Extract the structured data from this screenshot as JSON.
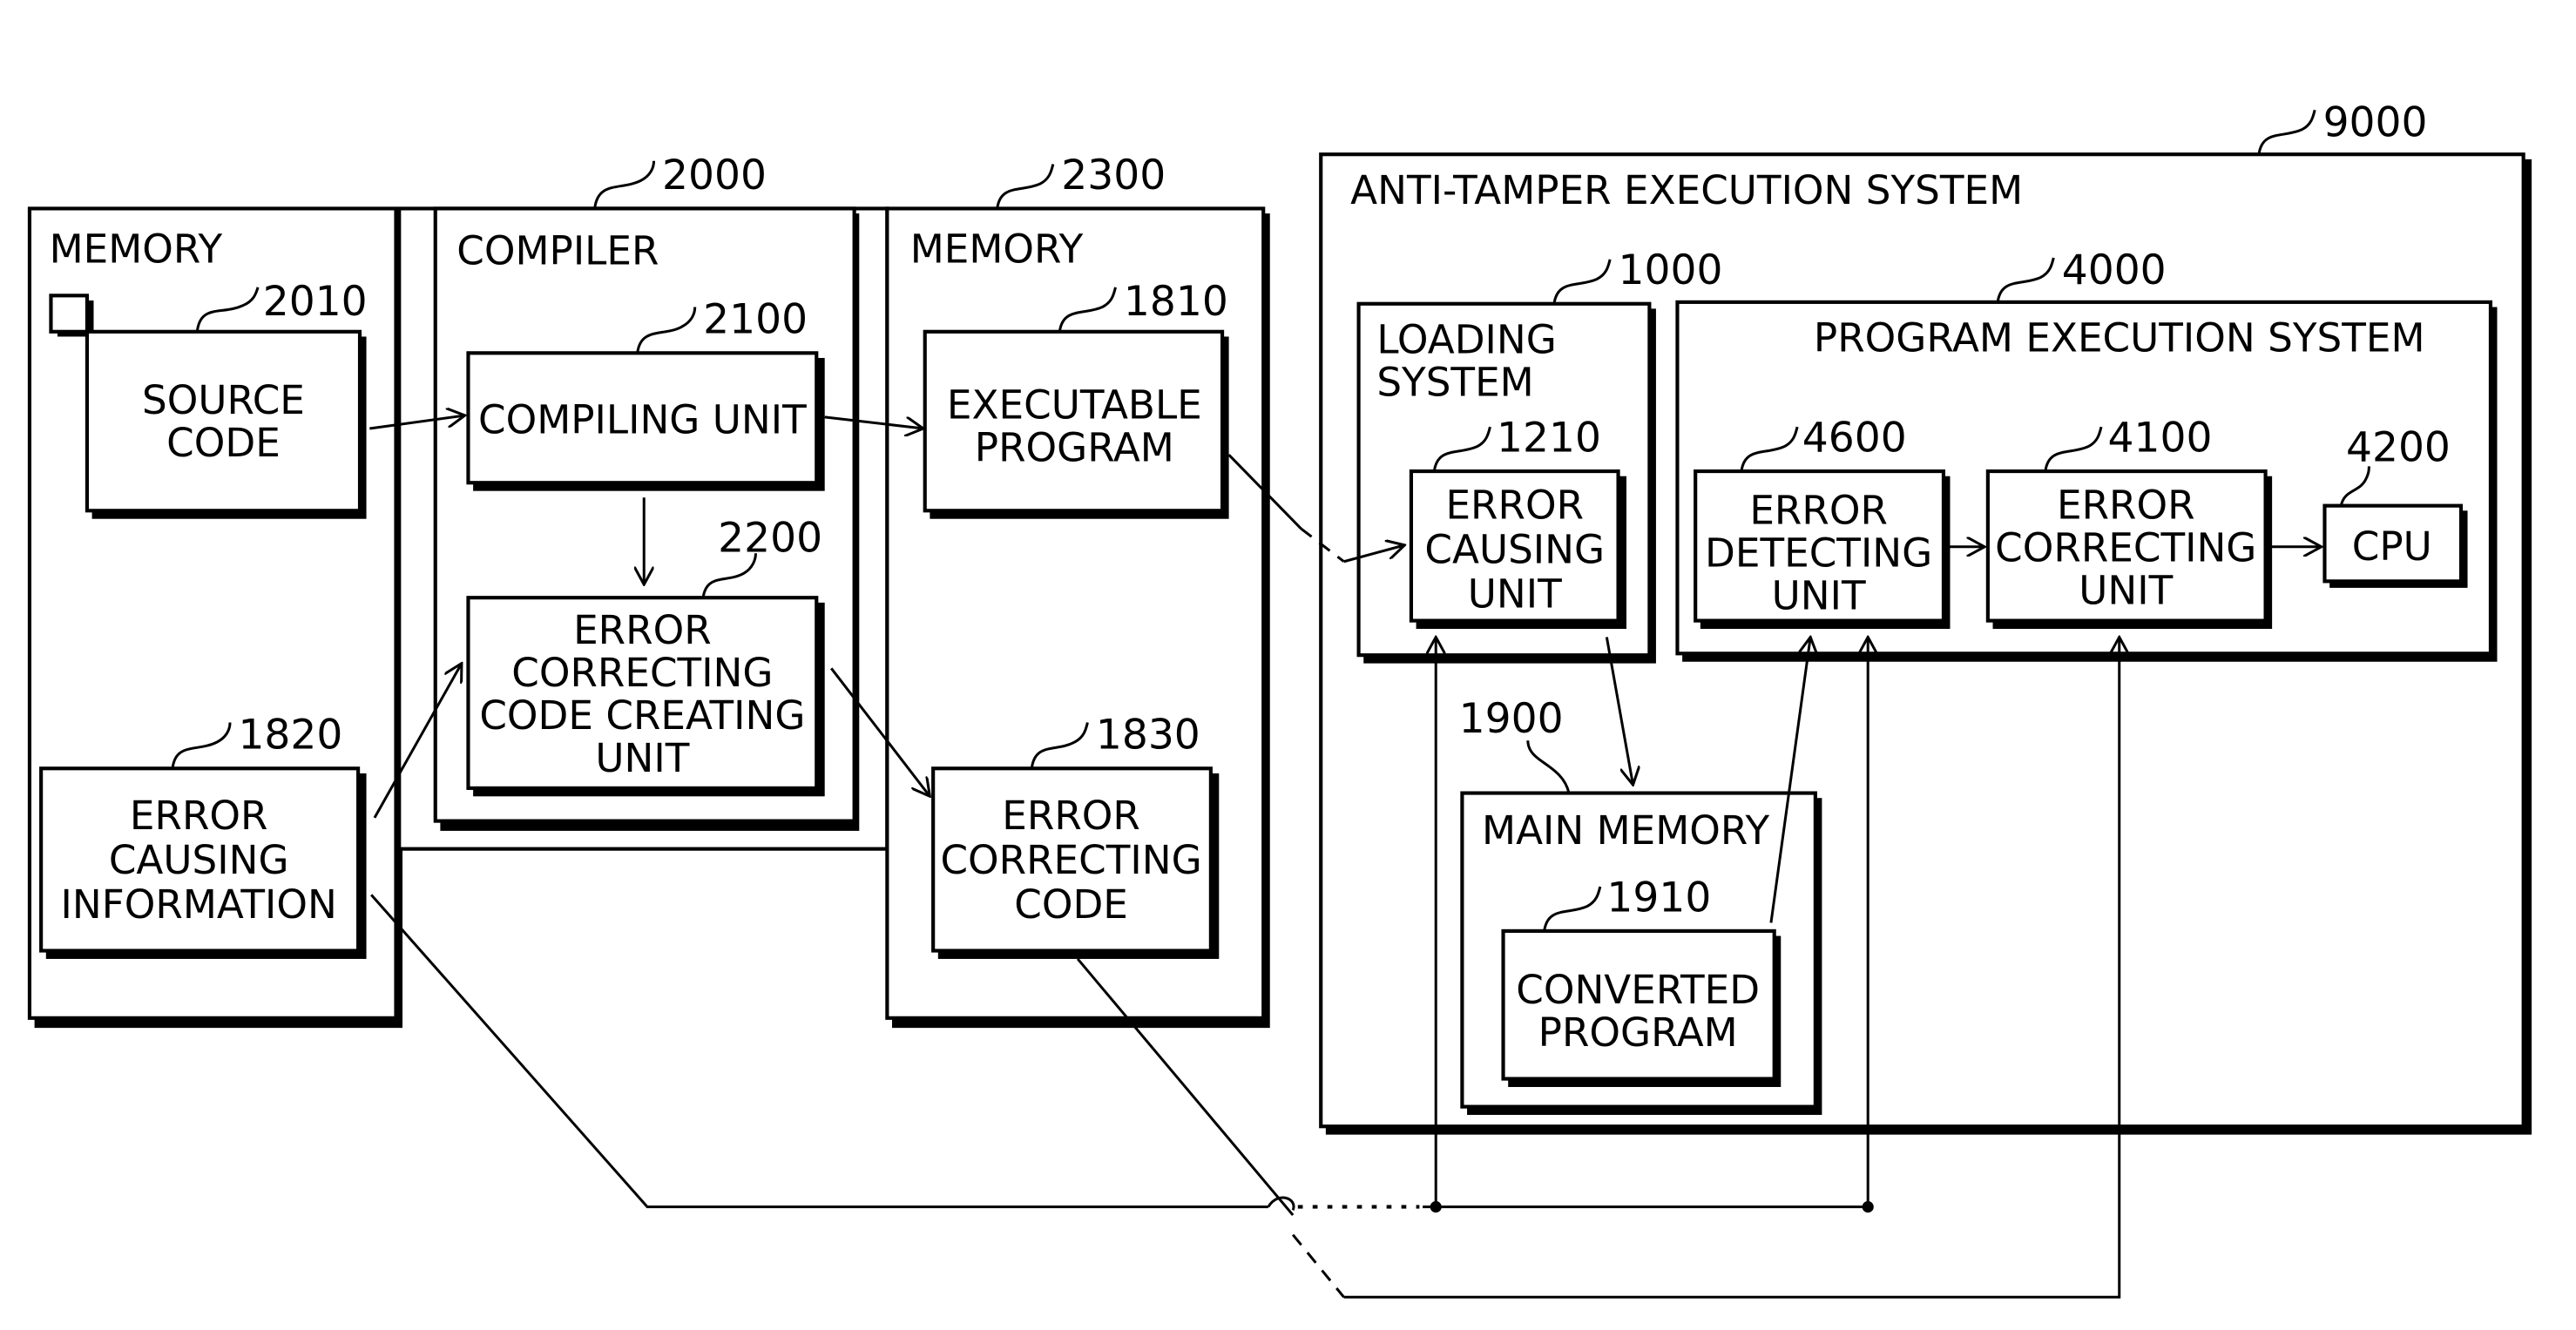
{
  "diagram": {
    "type": "block-diagram",
    "left_memory": {
      "title": "MEMORY",
      "source_code": {
        "ref": "2010",
        "lines": [
          "SOURCE",
          "CODE"
        ]
      },
      "error_causing_information": {
        "ref": "1820",
        "lines": [
          "ERROR",
          "CAUSING",
          "INFORMATION"
        ]
      }
    },
    "compiler": {
      "ref": "2000",
      "title": "COMPILER",
      "compiling_unit": {
        "ref": "2100",
        "lines": [
          "COMPILING UNIT"
        ]
      },
      "ecc_creating_unit": {
        "ref": "2200",
        "lines": [
          "ERROR",
          "CORRECTING",
          "CODE CREATING",
          "UNIT"
        ]
      }
    },
    "right_memory": {
      "ref": "2300",
      "title": "MEMORY",
      "executable_program": {
        "ref": "1810",
        "lines": [
          "EXECUTABLE",
          "PROGRAM"
        ]
      },
      "error_correcting_code": {
        "ref": "1830",
        "lines": [
          "ERROR",
          "CORRECTING",
          "CODE"
        ]
      }
    },
    "anti_tamper": {
      "ref": "9000",
      "title": "ANTI-TAMPER EXECUTION SYSTEM",
      "loading_system": {
        "ref": "1000",
        "lines": [
          "LOADING",
          "SYSTEM"
        ],
        "error_causing_unit": {
          "ref": "1210",
          "lines": [
            "ERROR",
            "CAUSING",
            "UNIT"
          ]
        }
      },
      "program_execution_system": {
        "ref": "4000",
        "title": "PROGRAM EXECUTION SYSTEM",
        "error_detecting_unit": {
          "ref": "4600",
          "lines": [
            "ERROR",
            "DETECTING",
            "UNIT"
          ]
        },
        "error_correcting_unit": {
          "ref": "4100",
          "lines": [
            "ERROR",
            "CORRECTING",
            "UNIT"
          ]
        },
        "cpu": {
          "ref": "4200",
          "lines": [
            "CPU"
          ]
        }
      },
      "main_memory": {
        "ref": "1900",
        "title": "MAIN MEMORY",
        "converted_program": {
          "ref": "1910",
          "lines": [
            "CONVERTED",
            "PROGRAM"
          ]
        }
      }
    }
  }
}
